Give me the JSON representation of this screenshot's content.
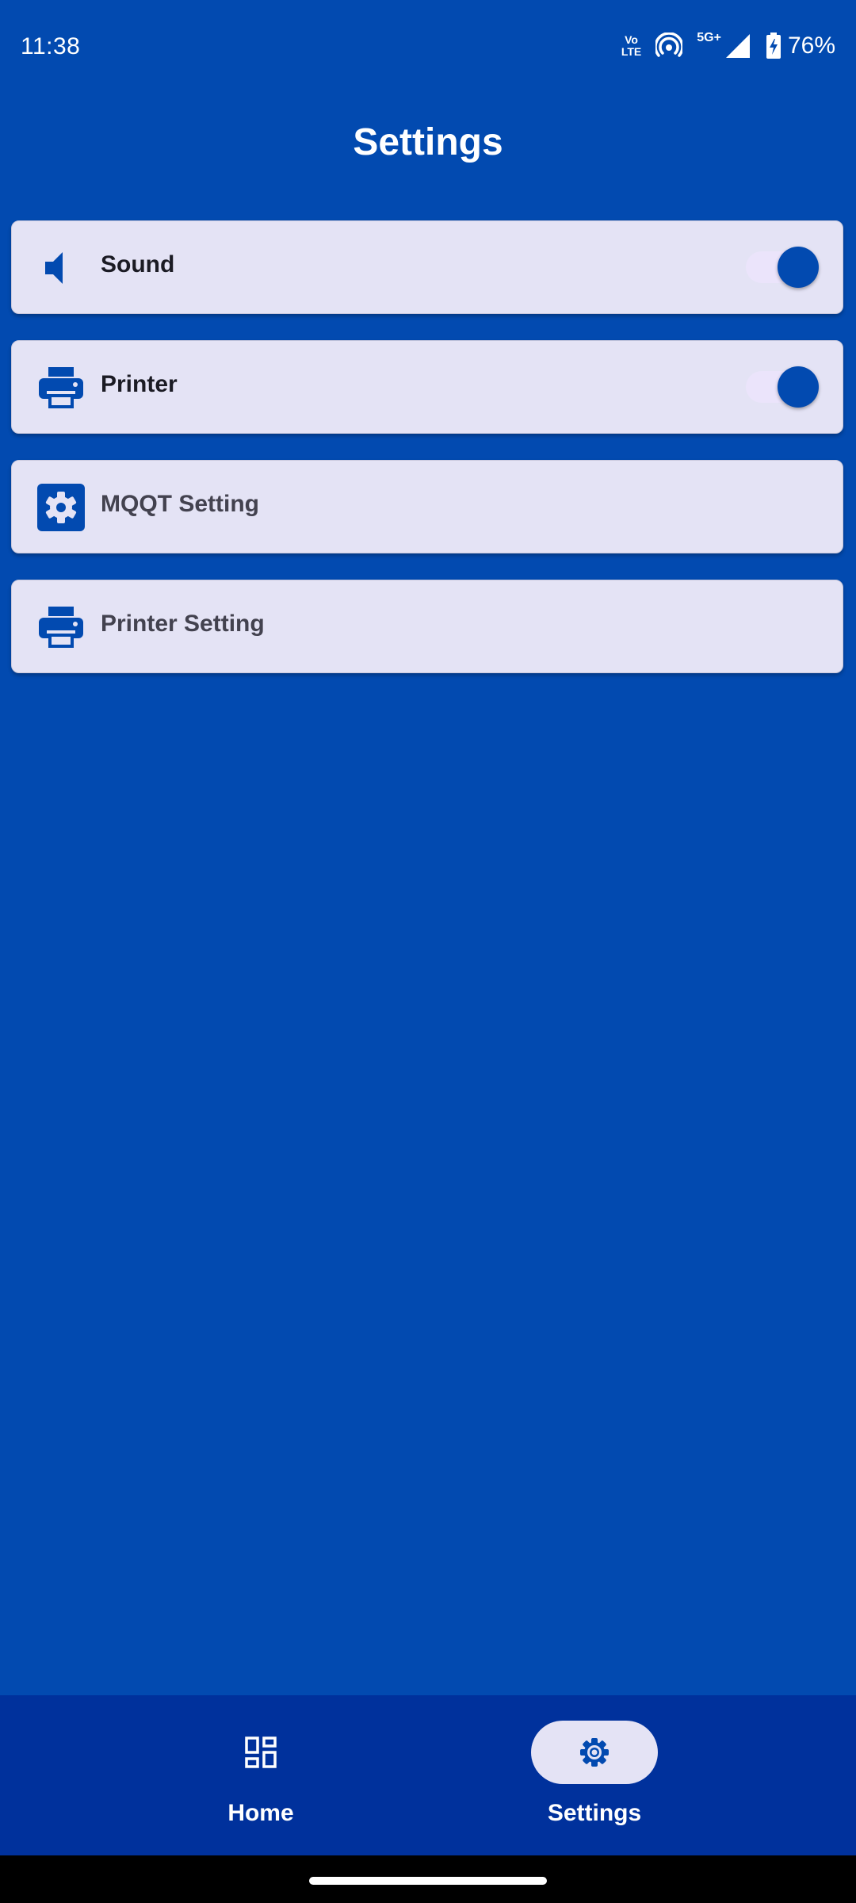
{
  "status_bar": {
    "time": "11:38",
    "volte_top": "Vo",
    "volte_bottom": "LTE",
    "network": "5G+",
    "battery": "76%"
  },
  "header": {
    "title": "Settings"
  },
  "settings": {
    "items": [
      {
        "label": "Sound",
        "icon": "speaker-icon",
        "toggle": true
      },
      {
        "label": "Printer",
        "icon": "printer-icon",
        "toggle": true
      },
      {
        "label": "MQQT Setting",
        "icon": "gear-icon"
      },
      {
        "label": "Printer Setting",
        "icon": "printer-icon"
      }
    ]
  },
  "bottom_nav": {
    "items": [
      {
        "label": "Home",
        "icon": "dashboard-icon",
        "active": false
      },
      {
        "label": "Settings",
        "icon": "gear-icon",
        "active": true
      }
    ]
  },
  "colors": {
    "background": "#024ab0",
    "card": "#e4e3f5",
    "nav": "#00319c",
    "accent": "#024ab0"
  }
}
